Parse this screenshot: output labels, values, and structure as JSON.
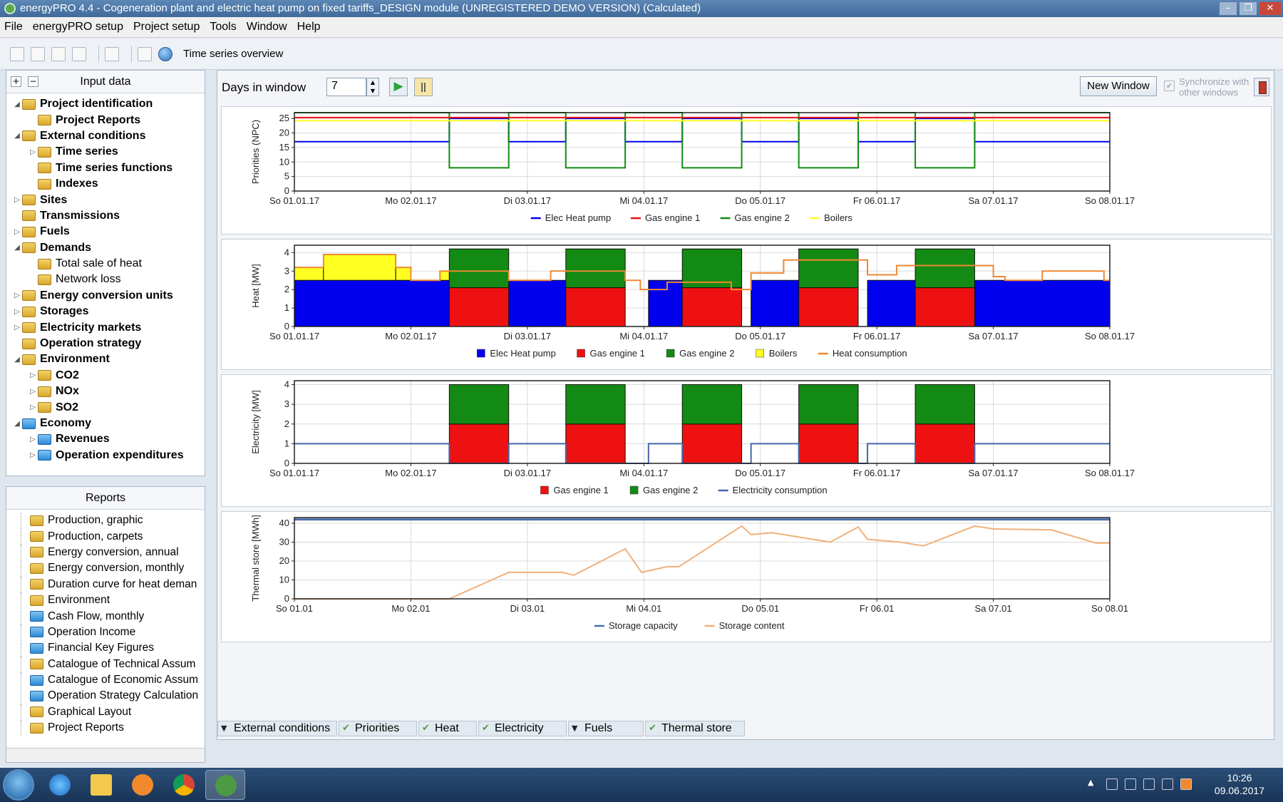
{
  "window": {
    "title": "energyPRO 4.4  -  Cogeneration plant and electric heat pump on fixed tariffs_DESIGN module  (UNREGISTERED DEMO VERSION) (Calculated)"
  },
  "menu": [
    "File",
    "energyPRO setup",
    "Project setup",
    "Tools",
    "Window",
    "Help"
  ],
  "toolbar": {
    "title": "Time series overview"
  },
  "input_panel": {
    "title": "Input data",
    "expand_all": "+",
    "collapse_all": "−",
    "items": [
      {
        "label": "Project identification",
        "indent": 0,
        "bold": true,
        "arrow": "◢",
        "icon": "folder"
      },
      {
        "label": "Project Reports",
        "indent": 1,
        "bold": true,
        "arrow": "",
        "icon": "folder"
      },
      {
        "label": "External conditions",
        "indent": 0,
        "bold": true,
        "arrow": "◢",
        "icon": "folder"
      },
      {
        "label": "Time series",
        "indent": 1,
        "bold": true,
        "arrow": "▷",
        "icon": "folder"
      },
      {
        "label": "Time series functions",
        "indent": 1,
        "bold": true,
        "arrow": "",
        "icon": "folder"
      },
      {
        "label": "Indexes",
        "indent": 1,
        "bold": true,
        "arrow": "",
        "icon": "folder"
      },
      {
        "label": "Sites",
        "indent": 0,
        "bold": true,
        "arrow": "▷",
        "icon": "folder"
      },
      {
        "label": "Transmissions",
        "indent": 0,
        "bold": true,
        "arrow": "",
        "icon": "folder"
      },
      {
        "label": "Fuels",
        "indent": 0,
        "bold": true,
        "arrow": "▷",
        "icon": "folder"
      },
      {
        "label": "Demands",
        "indent": 0,
        "bold": true,
        "arrow": "◢",
        "icon": "folder"
      },
      {
        "label": "Total sale of heat",
        "indent": 1,
        "bold": false,
        "arrow": "",
        "icon": "folder"
      },
      {
        "label": "Network loss",
        "indent": 1,
        "bold": false,
        "arrow": "",
        "icon": "folder"
      },
      {
        "label": "Energy conversion units",
        "indent": 0,
        "bold": true,
        "arrow": "▷",
        "icon": "folder"
      },
      {
        "label": "Storages",
        "indent": 0,
        "bold": true,
        "arrow": "▷",
        "icon": "folder"
      },
      {
        "label": "Electricity markets",
        "indent": 0,
        "bold": true,
        "arrow": "▷",
        "icon": "folder"
      },
      {
        "label": "Operation strategy",
        "indent": 0,
        "bold": true,
        "arrow": "",
        "icon": "folder"
      },
      {
        "label": "Environment",
        "indent": 0,
        "bold": true,
        "arrow": "◢",
        "icon": "folder"
      },
      {
        "label": "CO2",
        "indent": 1,
        "bold": true,
        "arrow": "▷",
        "icon": "folder"
      },
      {
        "label": "NOx",
        "indent": 1,
        "bold": true,
        "arrow": "▷",
        "icon": "folder"
      },
      {
        "label": "SO2",
        "indent": 1,
        "bold": true,
        "arrow": "▷",
        "icon": "folder"
      },
      {
        "label": "Economy",
        "indent": 0,
        "bold": true,
        "arrow": "◢",
        "icon": "folder-blue"
      },
      {
        "label": "Revenues",
        "indent": 1,
        "bold": true,
        "arrow": "▷",
        "icon": "folder-blue"
      },
      {
        "label": "Operation expenditures",
        "indent": 1,
        "bold": true,
        "arrow": "▷",
        "icon": "folder-blue"
      }
    ]
  },
  "reports_panel": {
    "title": "Reports",
    "items": [
      {
        "label": "Production, graphic",
        "icon": "folder"
      },
      {
        "label": "Production, carpets",
        "icon": "folder"
      },
      {
        "label": "Energy conversion, annual",
        "icon": "folder"
      },
      {
        "label": "Energy conversion, monthly",
        "icon": "folder"
      },
      {
        "label": "Duration curve for heat deman",
        "icon": "folder"
      },
      {
        "label": "Environment",
        "icon": "folder"
      },
      {
        "label": "Cash Flow, monthly",
        "icon": "folder-blue"
      },
      {
        "label": "Operation Income",
        "icon": "folder-blue"
      },
      {
        "label": "Financial Key Figures",
        "icon": "folder-blue"
      },
      {
        "label": "Catalogue of Technical Assum",
        "icon": "folder"
      },
      {
        "label": "Catalogue of Economic Assum",
        "icon": "folder-blue"
      },
      {
        "label": "Operation Strategy Calculation",
        "icon": "folder-blue"
      },
      {
        "label": "Graphical Layout",
        "icon": "folder"
      },
      {
        "label": "Project Reports",
        "icon": "folder"
      }
    ]
  },
  "controls": {
    "days_label": "Days in window",
    "days_value": "7",
    "new_window": "New Window",
    "sync_label": "Synchronize with other windows",
    "play_icon": "play-icon",
    "pause_icon": "pause-icon"
  },
  "colors": {
    "elec_heat_pump": "#0000ee",
    "gas_engine_1": "#ee1111",
    "gas_engine_2": "#138a13",
    "boilers": "#ffff22",
    "heat_consumption": "#ee8833",
    "electricity_consumption": "#4466aa",
    "storage_capacity": "#4a6ea8",
    "storage_content": "#f0b07a"
  },
  "chart_data": [
    {
      "type": "line",
      "ylabel": "Priorities (NPC)",
      "ylim": [
        0,
        27
      ],
      "yticks": [
        0,
        5,
        10,
        15,
        20,
        25
      ],
      "xticks": [
        "So 01.01.17",
        "Mo 02.01.17",
        "Di 03.01.17",
        "Mi 04.01.17",
        "Do 05.01.17",
        "Fr 06.01.17",
        "Sa 07.01.17",
        "So 08.01.17"
      ],
      "xlim": [
        0,
        7
      ],
      "legend": [
        "Elec Heat pump",
        "Gas engine 1",
        "Gas engine 2",
        "Boilers"
      ],
      "series": [
        {
          "name": "Elec Heat pump",
          "x": [
            0,
            1.33,
            1.33,
            1.84,
            1.84,
            2.33,
            2.33,
            2.84,
            2.84,
            3.33,
            3.33,
            3.84,
            3.84,
            4.33,
            4.33,
            4.84,
            4.84,
            5.33,
            5.33,
            5.84,
            5.84,
            7
          ],
          "y": [
            17,
            17,
            25,
            25,
            17,
            17,
            25,
            25,
            17,
            17,
            25,
            25,
            17,
            17,
            25,
            25,
            17,
            17,
            25,
            25,
            17,
            17
          ]
        },
        {
          "name": "Gas engine 2",
          "x": [
            0,
            1.33,
            1.33,
            1.84,
            1.84,
            2.33,
            2.33,
            2.84,
            2.84,
            3.33,
            3.33,
            3.84,
            3.84,
            4.33,
            4.33,
            4.84,
            4.84,
            5.33,
            5.33,
            5.84,
            5.84,
            7
          ],
          "y": [
            27,
            27,
            8,
            8,
            27,
            27,
            8,
            8,
            27,
            27,
            8,
            8,
            27,
            27,
            8,
            8,
            27,
            27,
            8,
            8,
            27,
            27
          ]
        },
        {
          "name": "Gas engine 1",
          "x": [
            0,
            7
          ],
          "y": [
            25.3,
            25.3
          ]
        },
        {
          "name": "Boilers",
          "x": [
            0,
            7
          ],
          "y": [
            24.2,
            24.2
          ]
        }
      ]
    },
    {
      "type": "area",
      "ylabel": "Heat [MW]",
      "ylim": [
        0,
        4.4
      ],
      "yticks": [
        0,
        1,
        2,
        3,
        4
      ],
      "xticks": [
        "So 01.01.17",
        "Mo 02.01.17",
        "Di 03.01.17",
        "Mi 04.01.17",
        "Do 05.01.17",
        "Fr 06.01.17",
        "Sa 07.01.17",
        "So 08.01.17"
      ],
      "xlim": [
        0,
        7
      ],
      "legend": [
        "Elec Heat pump",
        "Gas engine 1",
        "Gas engine 2",
        "Boilers",
        "Heat consumption"
      ],
      "blocks": [
        {
          "series": "Elec Heat pump",
          "x0": 0,
          "x1": 1.33,
          "y0": 0,
          "y1": 2.5
        },
        {
          "series": "Boilers",
          "x0": 0,
          "x1": 0.25,
          "y0": 2.5,
          "y1": 3.2
        },
        {
          "series": "Boilers",
          "x0": 0.25,
          "x1": 0.87,
          "y0": 2.5,
          "y1": 3.9
        },
        {
          "series": "Boilers",
          "x0": 0.87,
          "x1": 1.0,
          "y0": 2.5,
          "y1": 3.2
        },
        {
          "series": "Boilers",
          "x0": 1.25,
          "x1": 1.33,
          "y0": 2.5,
          "y1": 3.0
        },
        {
          "series": "Gas engine 1",
          "x0": 1.33,
          "x1": 1.84,
          "y0": 0,
          "y1": 2.1
        },
        {
          "series": "Gas engine 2",
          "x0": 1.33,
          "x1": 1.84,
          "y0": 2.1,
          "y1": 4.2
        },
        {
          "series": "Elec Heat pump",
          "x0": 1.84,
          "x1": 2.33,
          "y0": 0,
          "y1": 2.5
        },
        {
          "series": "Gas engine 1",
          "x0": 2.33,
          "x1": 2.84,
          "y0": 0,
          "y1": 2.1
        },
        {
          "series": "Gas engine 2",
          "x0": 2.33,
          "x1": 2.84,
          "y0": 2.1,
          "y1": 4.2
        },
        {
          "series": "Elec Heat pump",
          "x0": 3.04,
          "x1": 3.33,
          "y0": 0,
          "y1": 2.5
        },
        {
          "series": "Gas engine 1",
          "x0": 3.33,
          "x1": 3.84,
          "y0": 0,
          "y1": 2.1
        },
        {
          "series": "Gas engine 2",
          "x0": 3.33,
          "x1": 3.84,
          "y0": 2.1,
          "y1": 4.2
        },
        {
          "series": "Elec Heat pump",
          "x0": 3.92,
          "x1": 4.33,
          "y0": 0,
          "y1": 2.5
        },
        {
          "series": "Gas engine 1",
          "x0": 4.33,
          "x1": 4.84,
          "y0": 0,
          "y1": 2.1
        },
        {
          "series": "Gas engine 2",
          "x0": 4.33,
          "x1": 4.84,
          "y0": 2.1,
          "y1": 4.2
        },
        {
          "series": "Elec Heat pump",
          "x0": 4.92,
          "x1": 5.33,
          "y0": 0,
          "y1": 2.5
        },
        {
          "series": "Gas engine 1",
          "x0": 5.33,
          "x1": 5.84,
          "y0": 0,
          "y1": 2.1
        },
        {
          "series": "Gas engine 2",
          "x0": 5.33,
          "x1": 5.84,
          "y0": 2.1,
          "y1": 4.2
        },
        {
          "series": "Elec Heat pump",
          "x0": 5.84,
          "x1": 7,
          "y0": 0,
          "y1": 2.5
        }
      ],
      "line": {
        "name": "Heat consumption",
        "x": [
          0,
          0.25,
          0.25,
          0.87,
          0.87,
          1.0,
          1.0,
          1.25,
          1.25,
          1.84,
          1.84,
          2.2,
          2.2,
          2.84,
          2.84,
          2.97,
          2.97,
          3.2,
          3.2,
          3.75,
          3.75,
          3.92,
          3.92,
          4.2,
          4.2,
          4.45,
          4.45,
          4.92,
          4.92,
          5.17,
          5.17,
          5.45,
          5.45,
          6.0,
          6.0,
          6.1,
          6.1,
          6.42,
          6.42,
          6.95,
          6.95,
          7
        ],
        "y": [
          3.2,
          3.2,
          3.9,
          3.9,
          3.2,
          3.2,
          2.5,
          2.5,
          3.0,
          3.0,
          2.5,
          2.5,
          3.0,
          3.0,
          2.5,
          2.5,
          2.0,
          2.0,
          2.4,
          2.4,
          2.0,
          2.0,
          2.9,
          2.9,
          3.6,
          3.6,
          3.6,
          3.6,
          2.8,
          2.8,
          3.3,
          3.3,
          3.3,
          3.3,
          2.7,
          2.7,
          2.5,
          2.5,
          3.0,
          3.0,
          2.5,
          2.5
        ]
      }
    },
    {
      "type": "area",
      "ylabel": "Electricity [MW]",
      "ylim": [
        0,
        4.2
      ],
      "yticks": [
        0,
        1,
        2,
        3,
        4
      ],
      "xticks": [
        "So 01.01.17",
        "Mo 02.01.17",
        "Di 03.01.17",
        "Mi 04.01.17",
        "Do 05.01.17",
        "Fr 06.01.17",
        "Sa 07.01.17",
        "So 08.01.17"
      ],
      "xlim": [
        0,
        7
      ],
      "legend": [
        "Gas engine 1",
        "Gas engine 2",
        "Electricity consumption"
      ],
      "blocks": [
        {
          "series": "Gas engine 1",
          "x0": 1.33,
          "x1": 1.84,
          "y0": 0,
          "y1": 2
        },
        {
          "series": "Gas engine 2",
          "x0": 1.33,
          "x1": 1.84,
          "y0": 2,
          "y1": 4
        },
        {
          "series": "Gas engine 1",
          "x0": 2.33,
          "x1": 2.84,
          "y0": 0,
          "y1": 2
        },
        {
          "series": "Gas engine 2",
          "x0": 2.33,
          "x1": 2.84,
          "y0": 2,
          "y1": 4
        },
        {
          "series": "Gas engine 1",
          "x0": 3.33,
          "x1": 3.84,
          "y0": 0,
          "y1": 2
        },
        {
          "series": "Gas engine 2",
          "x0": 3.33,
          "x1": 3.84,
          "y0": 2,
          "y1": 4
        },
        {
          "series": "Gas engine 1",
          "x0": 4.33,
          "x1": 4.84,
          "y0": 0,
          "y1": 2
        },
        {
          "series": "Gas engine 2",
          "x0": 4.33,
          "x1": 4.84,
          "y0": 2,
          "y1": 4
        },
        {
          "series": "Gas engine 1",
          "x0": 5.33,
          "x1": 5.84,
          "y0": 0,
          "y1": 2
        },
        {
          "series": "Gas engine 2",
          "x0": 5.33,
          "x1": 5.84,
          "y0": 2,
          "y1": 4
        }
      ],
      "line": {
        "name": "Electricity consumption",
        "x": [
          0,
          1.33,
          1.33,
          1.84,
          1.84,
          2.33,
          2.33,
          2.84,
          2.84,
          3.04,
          3.04,
          3.33,
          3.33,
          3.84,
          3.84,
          3.92,
          3.92,
          4.33,
          4.33,
          4.84,
          4.84,
          4.92,
          4.92,
          5.33,
          5.33,
          5.84,
          5.84,
          7
        ],
        "y": [
          1,
          1,
          0,
          0,
          1,
          1,
          0,
          0,
          0,
          0,
          1,
          1,
          0,
          0,
          0,
          0,
          1,
          1,
          0,
          0,
          0,
          0,
          1,
          1,
          0,
          0,
          1,
          1
        ]
      }
    },
    {
      "type": "line",
      "ylabel": "Thermal store [MWh]",
      "ylim": [
        0,
        43
      ],
      "yticks": [
        0,
        10,
        20,
        30,
        40
      ],
      "xticks": [
        "So 01.01",
        "Mo 02.01",
        "Di 03.01",
        "Mi 04.01",
        "Do 05.01",
        "Fr 06.01",
        "Sa 07.01",
        "So 08.01"
      ],
      "xlim": [
        0,
        7
      ],
      "legend": [
        "Storage capacity",
        "Storage content"
      ],
      "series": [
        {
          "name": "Storage capacity",
          "x": [
            0,
            7
          ],
          "y": [
            42,
            42
          ]
        },
        {
          "name": "Storage content",
          "x": [
            0,
            1.33,
            1.84,
            2.3,
            2.4,
            2.84,
            2.98,
            3.2,
            3.3,
            3.84,
            3.92,
            4.1,
            4.6,
            4.84,
            4.92,
            5.2,
            5.4,
            5.84,
            6.0,
            6.5,
            6.88,
            7
          ],
          "y": [
            0,
            0,
            14,
            14,
            12.5,
            26.5,
            14,
            17,
            17,
            38.5,
            34,
            35,
            30,
            38,
            31.5,
            30,
            28,
            38.5,
            37,
            36.5,
            29.5,
            29.5
          ]
        }
      ]
    }
  ],
  "bottom_tabs": [
    {
      "label": "External conditions",
      "mark": "▼",
      "kind": "tri"
    },
    {
      "label": "Priorities",
      "mark": "✔",
      "kind": "check"
    },
    {
      "label": "Heat",
      "mark": "✔",
      "kind": "check"
    },
    {
      "label": "Electricity",
      "mark": "✔",
      "kind": "check"
    },
    {
      "label": "Fuels",
      "mark": "▼",
      "kind": "tri"
    },
    {
      "label": "Thermal store",
      "mark": "✔",
      "kind": "check"
    }
  ],
  "taskbar": {
    "time": "10:26",
    "date": "09.06.2017"
  }
}
